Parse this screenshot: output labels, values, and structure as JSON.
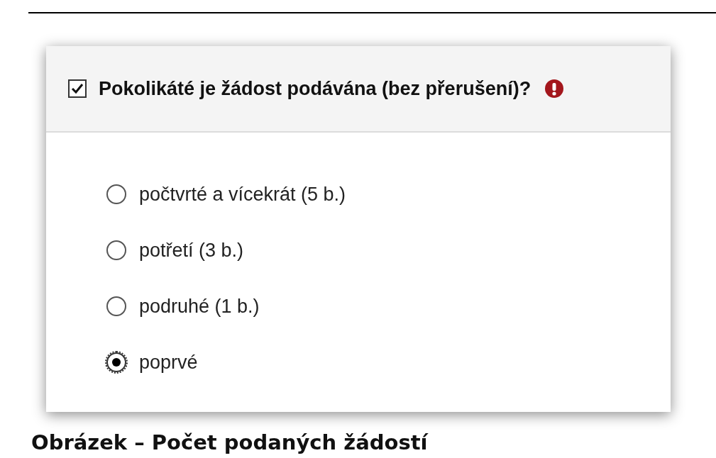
{
  "question": {
    "label": "Pokolikáté je žádost podávána (bez přerušení)?",
    "checked": true
  },
  "options": [
    {
      "label": "počtvrté a vícekrát (5 b.)",
      "selected": false
    },
    {
      "label": "potřetí (3 b.)",
      "selected": false
    },
    {
      "label": "podruhé (1 b.)",
      "selected": false
    },
    {
      "label": "poprvé",
      "selected": true
    }
  ],
  "caption": "Obrázek – Počet podaných žádostí"
}
